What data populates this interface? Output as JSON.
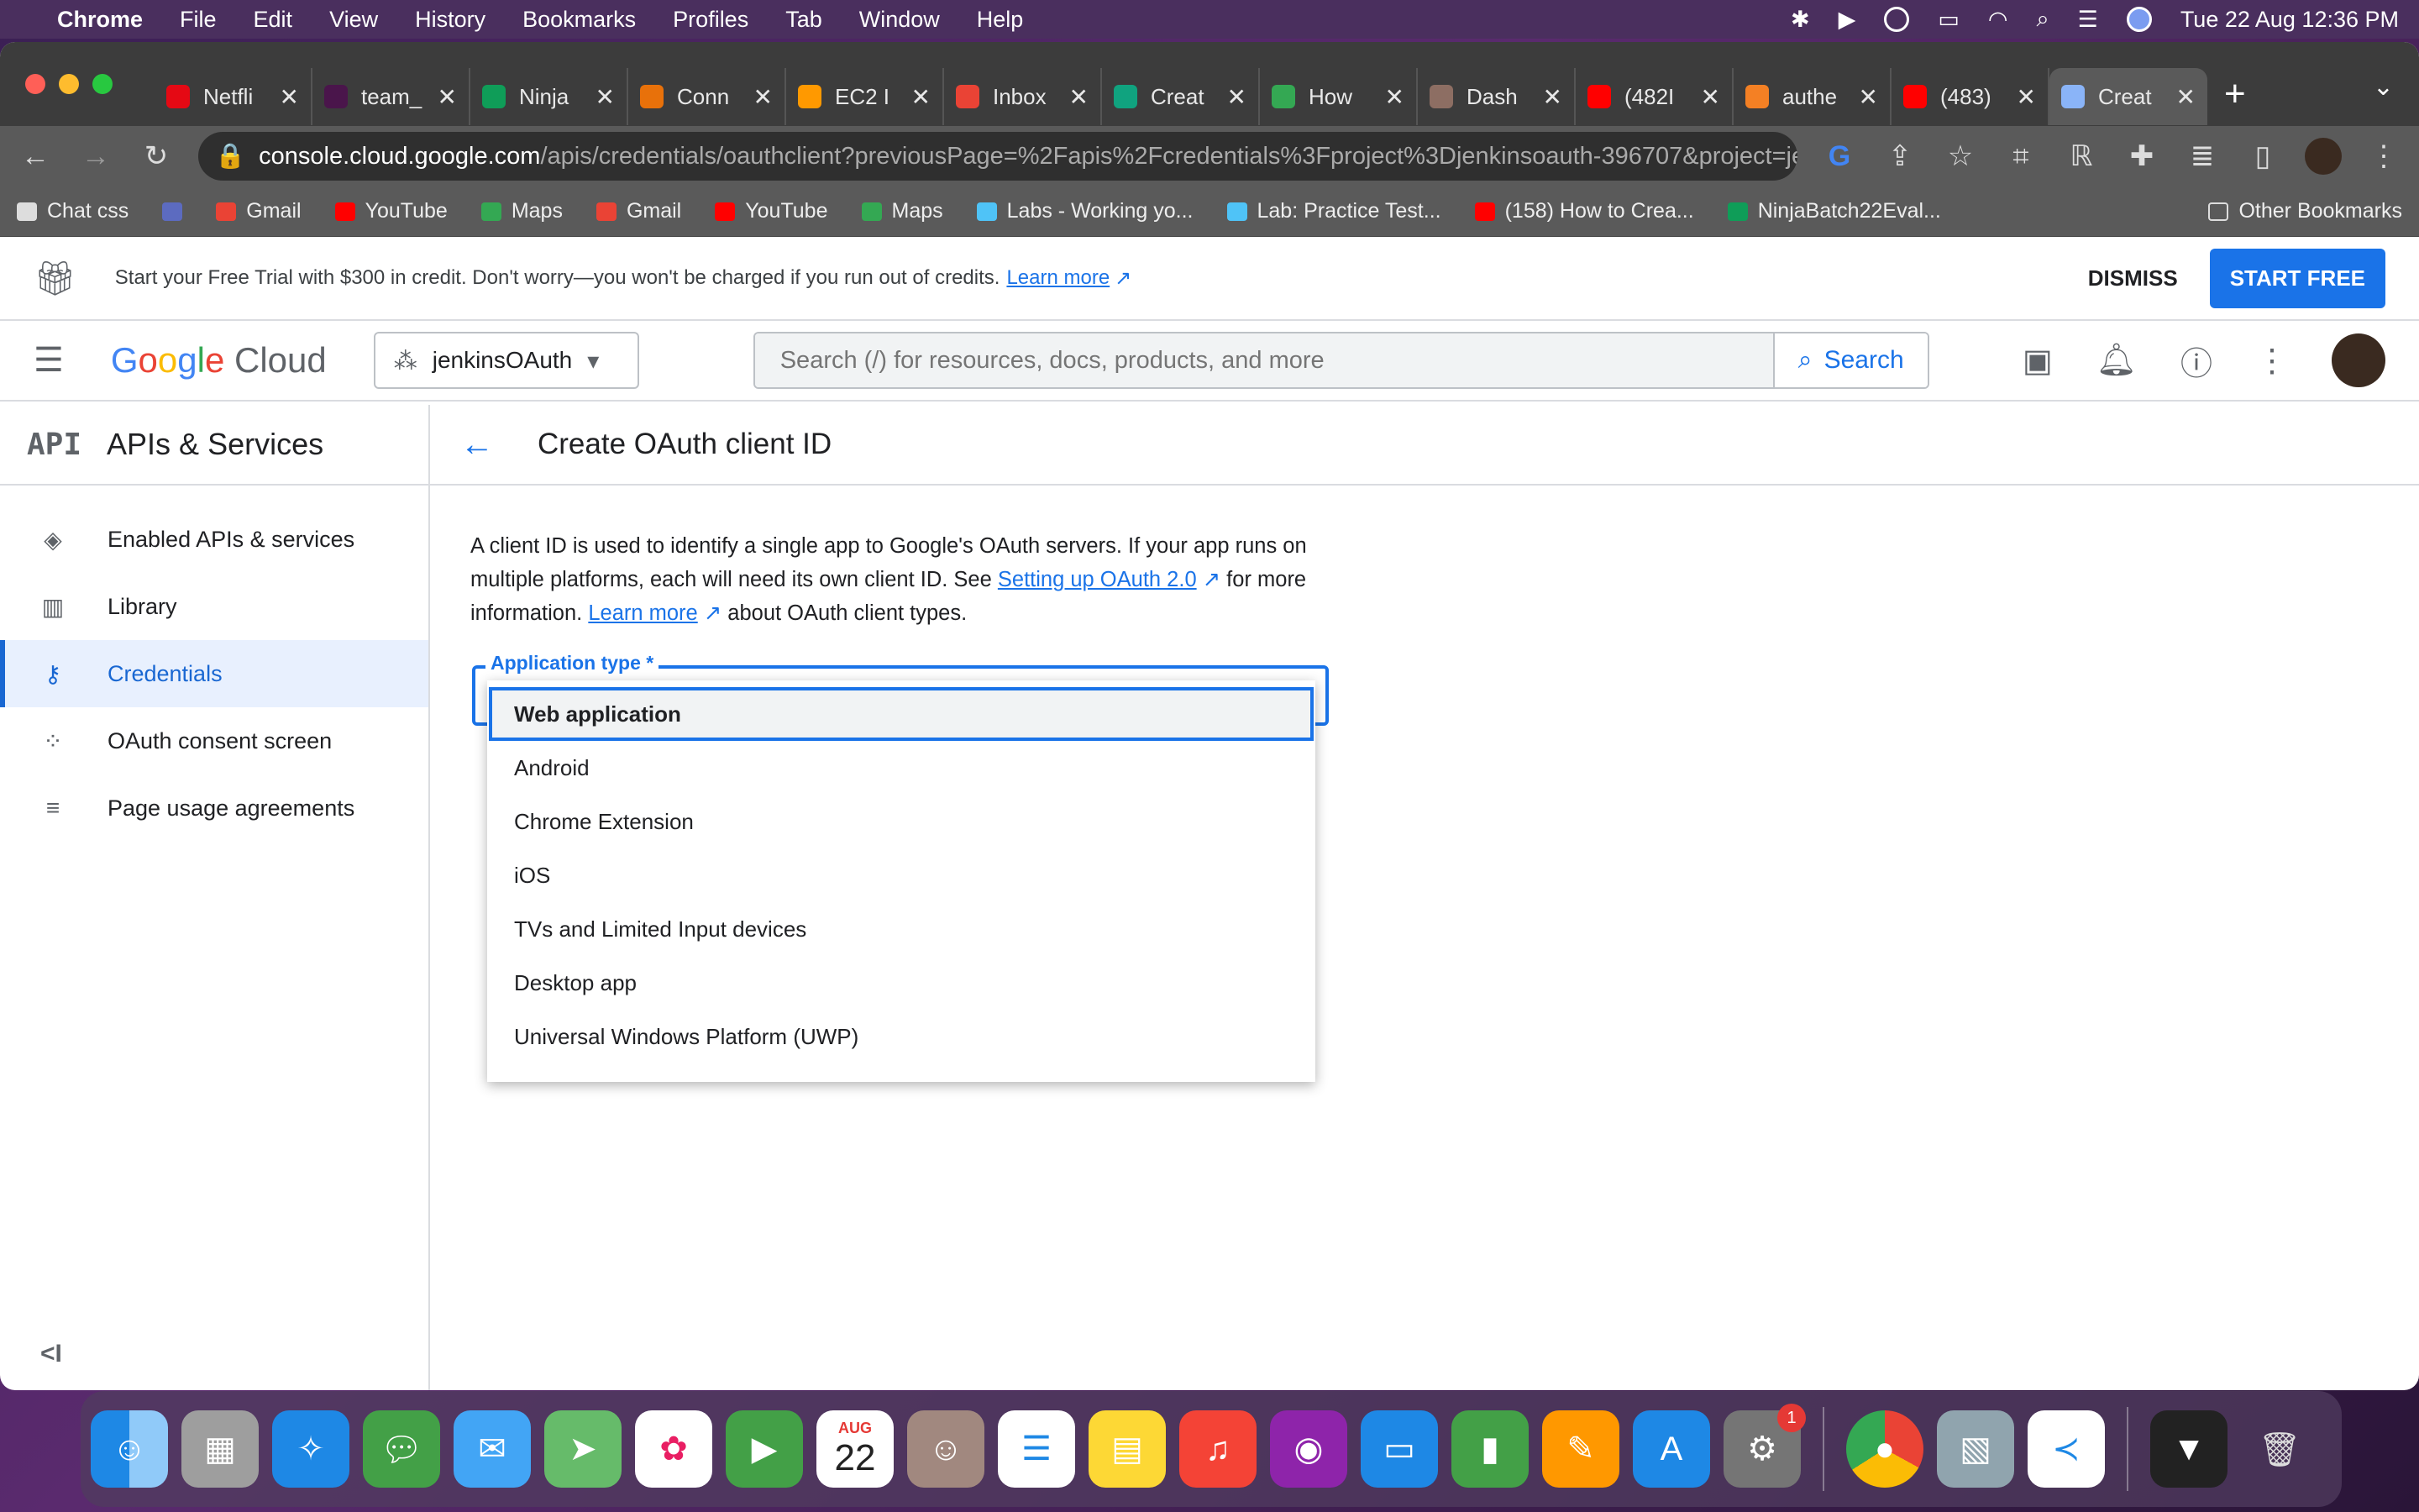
{
  "menubar": {
    "app": "Chrome",
    "items": [
      "File",
      "Edit",
      "View",
      "History",
      "Bookmarks",
      "Profiles",
      "Tab",
      "Window",
      "Help"
    ],
    "datetime": "Tue 22 Aug  12:36 PM"
  },
  "tabs": [
    {
      "title": "Netfli",
      "color": "#e50914"
    },
    {
      "title": "team_",
      "color": "#4a154b"
    },
    {
      "title": "Ninja",
      "color": "#0f9d58"
    },
    {
      "title": "Conn",
      "color": "#e8710a"
    },
    {
      "title": "EC2 I",
      "color": "#ff9900"
    },
    {
      "title": "Inbox",
      "color": "#ea4335"
    },
    {
      "title": "Creat",
      "color": "#10a37f"
    },
    {
      "title": "How",
      "color": "#34a853"
    },
    {
      "title": "Dash",
      "color": "#8d6e63"
    },
    {
      "title": "(482I",
      "color": "#ff0000"
    },
    {
      "title": "authe",
      "color": "#f48024"
    },
    {
      "title": "(483)",
      "color": "#ff0000"
    },
    {
      "title": "Creat",
      "color": "#8ab4f8"
    }
  ],
  "omnibox": {
    "host": "console.cloud.google.com",
    "path": "/apis/credentials/oauthclient?previousPage=%2Fapis%2Fcredentials%3Fproject%3Djenkinsoauth-396707&project=je..."
  },
  "bookmarks": {
    "items": [
      {
        "label": "Chat css",
        "color": "#ddd"
      },
      {
        "label": "",
        "color": "#5c6bc0"
      },
      {
        "label": "Gmail",
        "color": "#ea4335"
      },
      {
        "label": "YouTube",
        "color": "#ff0000"
      },
      {
        "label": "Maps",
        "color": "#34a853"
      },
      {
        "label": "Gmail",
        "color": "#ea4335"
      },
      {
        "label": "YouTube",
        "color": "#ff0000"
      },
      {
        "label": "Maps",
        "color": "#34a853"
      },
      {
        "label": "Labs - Working yo...",
        "color": "#4fc3f7"
      },
      {
        "label": "Lab: Practice Test...",
        "color": "#4fc3f7"
      },
      {
        "label": "(158) How to Crea...",
        "color": "#ff0000"
      },
      {
        "label": "NinjaBatch22Eval...",
        "color": "#0f9d58"
      }
    ],
    "other": "Other Bookmarks"
  },
  "trial": {
    "text": "Start your Free Trial with $300 in credit. Don't worry—you won't be charged if you run out of credits.",
    "learn_more": "Learn more",
    "dismiss": "DISMISS",
    "start": "START FREE"
  },
  "header": {
    "project": "jenkinsOAuth",
    "search_placeholder": "Search (/) for resources, docs, products, and more",
    "search_button": "Search"
  },
  "sidebar": {
    "badge": "API",
    "title": "APIs & Services",
    "items": [
      {
        "label": "Enabled APIs & services",
        "icon": "◈"
      },
      {
        "label": "Library",
        "icon": "▥"
      },
      {
        "label": "Credentials",
        "icon": "⚷"
      },
      {
        "label": "OAuth consent screen",
        "icon": "⁘"
      },
      {
        "label": "Page usage agreements",
        "icon": "≡"
      }
    ],
    "collapse": "<I"
  },
  "page": {
    "title": "Create OAuth client ID",
    "desc1": "A client ID is used to identify a single app to Google's OAuth servers. If your app runs on multiple platforms, each will need its own client ID. See",
    "link1": "Setting up OAuth 2.0",
    "desc2": "for more information.",
    "link2": "Learn more",
    "desc3": "about OAuth client types.",
    "field_label": "Application type *"
  },
  "dropdown": {
    "selected": "Web application",
    "options": [
      "Web application",
      "Android",
      "Chrome Extension",
      "iOS",
      "TVs and Limited Input devices",
      "Desktop app",
      "Universal Windows Platform (UWP)"
    ]
  },
  "dock": {
    "calendar_month": "AUG",
    "calendar_day": "22",
    "settings_badge": "1"
  }
}
